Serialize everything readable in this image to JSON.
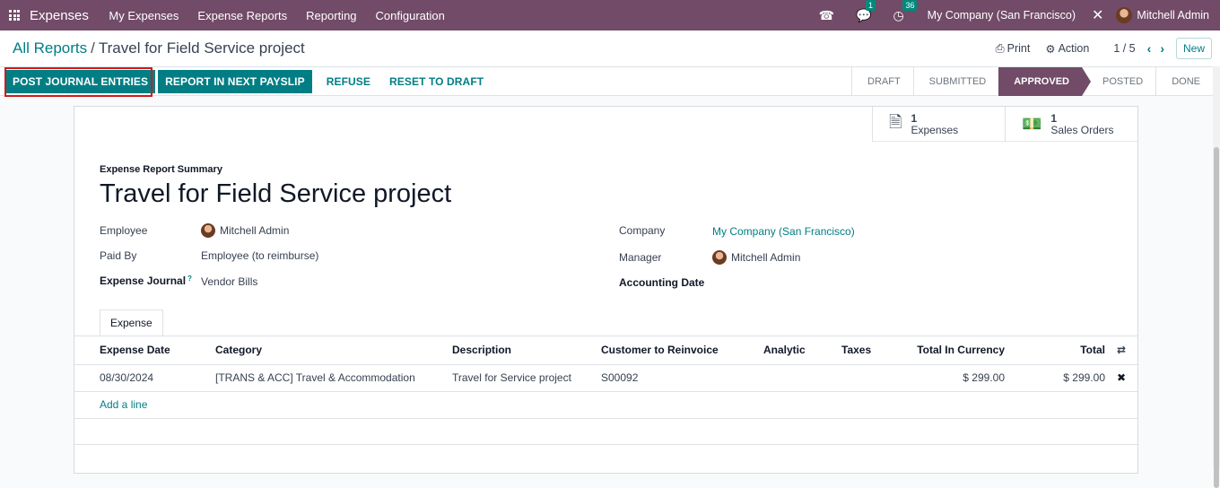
{
  "navbar": {
    "brand": "Expenses",
    "menu": [
      "My Expenses",
      "Expense Reports",
      "Reporting",
      "Configuration"
    ],
    "messages_badge": "1",
    "activities_badge": "36",
    "company": "My Company (San Francisco)",
    "user": "Mitchell Admin",
    "colors": {
      "primary": "#714b67",
      "accent": "#017e84",
      "badge": "#018a7c"
    }
  },
  "control": {
    "breadcrumb_parent": "All Reports",
    "breadcrumb_current": "Travel for Field Service project",
    "print_label": "Print",
    "action_label": "Action",
    "pager": "1 / 5",
    "new_label": "New"
  },
  "statusbar": {
    "actions": [
      "POST JOURNAL ENTRIES",
      "REPORT IN NEXT PAYSLIP",
      "REFUSE",
      "RESET TO DRAFT"
    ],
    "stages": [
      "DRAFT",
      "SUBMITTED",
      "APPROVED",
      "POSTED",
      "DONE"
    ],
    "active_stage": "APPROVED"
  },
  "smart_buttons": [
    {
      "count": "1",
      "label": "Expenses",
      "icon": "document-icon"
    },
    {
      "count": "1",
      "label": "Sales Orders",
      "icon": "money-icon"
    }
  ],
  "form": {
    "subtitle": "Expense Report Summary",
    "title": "Travel for Field Service project",
    "employee_label": "Employee",
    "employee_value": "Mitchell Admin",
    "paid_by_label": "Paid By",
    "paid_by_value": "Employee (to reimburse)",
    "journal_label": "Expense Journal",
    "journal_help": "?",
    "journal_value": "Vendor Bills",
    "company_label": "Company",
    "company_value": "My Company (San Francisco)",
    "manager_label": "Manager",
    "manager_value": "Mitchell Admin",
    "accounting_date_label": "Accounting Date",
    "accounting_date_value": ""
  },
  "tabs": [
    "Expense"
  ],
  "lines": {
    "columns": [
      "Expense Date",
      "Category",
      "Description",
      "Customer to Reinvoice",
      "Analytic",
      "Taxes",
      "Total In Currency",
      "Total"
    ],
    "rows": [
      {
        "date": "08/30/2024",
        "category": "[TRANS & ACC] Travel & Accommodation",
        "description": "Travel for Service project",
        "customer": "S00092",
        "analytic": "",
        "taxes": "",
        "total_currency": "$ 299.00",
        "total": "$ 299.00"
      }
    ],
    "add_line": "Add a line"
  }
}
